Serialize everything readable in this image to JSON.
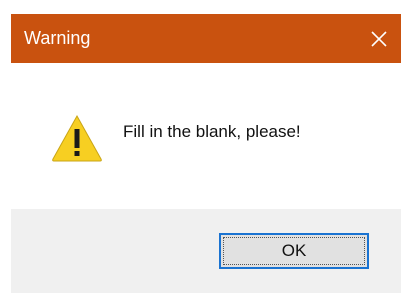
{
  "window": {
    "title": "Warning",
    "titlebar_color": "#c9520f",
    "close_icon": "close-icon"
  },
  "content": {
    "icon": "warning-icon",
    "message": "Fill in the blank, please!"
  },
  "footer": {
    "ok_label": "OK",
    "focus_color": "#1a73d1"
  }
}
